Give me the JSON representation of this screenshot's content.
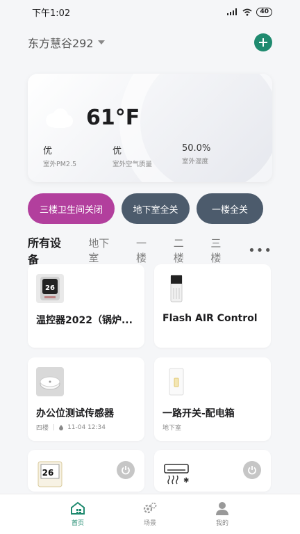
{
  "status_bar": {
    "time": "下午1:02",
    "battery": "40"
  },
  "header": {
    "home_name": "东方慧谷292"
  },
  "weather": {
    "temperature": "61°F",
    "metrics": [
      {
        "value": "优",
        "label": "室外PM2.5"
      },
      {
        "value": "优",
        "label": "室外空气质量"
      },
      {
        "value": "50.0%",
        "label": "室外湿度"
      }
    ]
  },
  "scenes": [
    {
      "label": "三楼卫生间关闭",
      "color": "#b23f9d"
    },
    {
      "label": "地下室全关",
      "color": "#4c5b6c"
    },
    {
      "label": "一楼全关",
      "color": "#4c5b6c"
    }
  ],
  "tabs": [
    "所有设备",
    "地下室",
    "一楼",
    "二楼",
    "三楼"
  ],
  "devices": [
    {
      "name": "温控器2022（锅炉...",
      "icon": "thermostat-icon"
    },
    {
      "name": "Flash AIR Control",
      "icon": "air-purifier-icon"
    },
    {
      "name": "办公位测试传感器",
      "room": "四楼",
      "time": "11-04 12:34",
      "icon": "sensor-icon"
    },
    {
      "name": "一路开关-配电箱",
      "room": "地下室",
      "icon": "switch-icon"
    },
    {
      "name": "",
      "icon": "thermostat-icon",
      "display": "26"
    },
    {
      "name": "",
      "icon": "air-conditioner-icon"
    }
  ],
  "thermostat_display": "26",
  "nav": [
    {
      "label": "首页",
      "icon": "home-icon",
      "active": true
    },
    {
      "label": "场景",
      "icon": "scene-icon"
    },
    {
      "label": "我的",
      "icon": "profile-icon"
    }
  ],
  "colors": {
    "accent": "#1f8a6f",
    "scene_primary": "#b23f9d",
    "scene_secondary": "#4c5b6c"
  }
}
